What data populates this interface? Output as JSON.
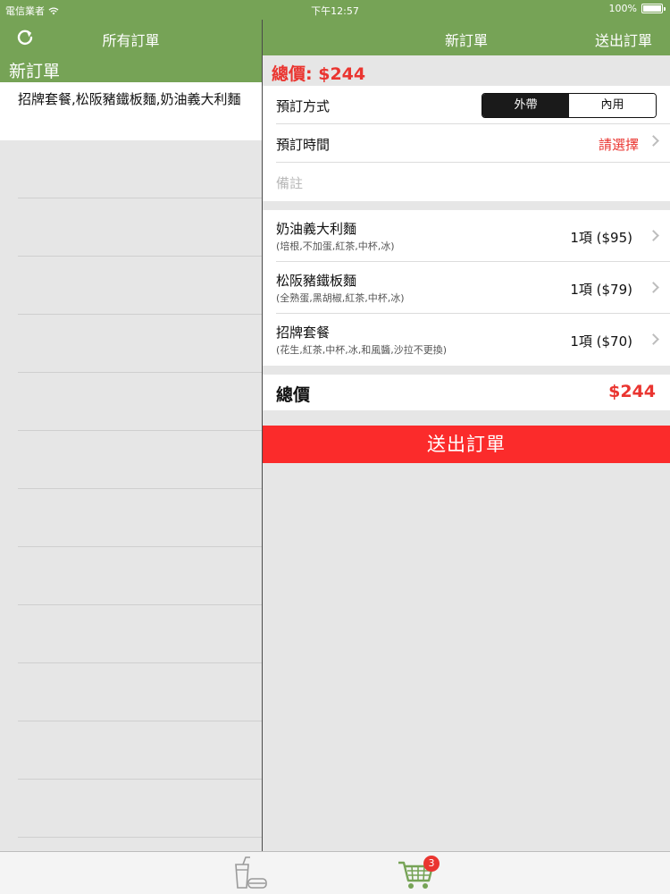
{
  "status": {
    "carrier": "電信業者",
    "time": "下午12:57",
    "battery": "100%"
  },
  "left_nav": {
    "title": "所有訂單"
  },
  "right_nav": {
    "title": "新訂單",
    "action": "送出訂單"
  },
  "orders": {
    "section_title": "新訂單",
    "items": [
      "招牌套餐,松阪豬鐵板麵,奶油義大利麵"
    ]
  },
  "summary": {
    "total_label": "總價:",
    "total_value": "$244"
  },
  "form": {
    "method_label": "預訂方式",
    "method_options": [
      "外帶",
      "內用"
    ],
    "method_selected": "外帶",
    "time_label": "預訂時間",
    "time_value": "請選擇",
    "note_placeholder": "備註"
  },
  "cart_items": [
    {
      "name": "奶油義大利麵",
      "options": "(培根,不加蛋,紅茶,中杯,冰)",
      "qty": "1項 ($95)"
    },
    {
      "name": "松阪豬鐵板麵",
      "options": "(全熟蛋,黑胡椒,紅茶,中杯,冰)",
      "qty": "1項 ($79)"
    },
    {
      "name": "招牌套餐",
      "options": "(花生,紅茶,中杯,冰,和風醬,沙拉不更換)",
      "qty": "1項 ($70)"
    }
  ],
  "total": {
    "label": "總價",
    "value": "$244"
  },
  "submit_label": "送出訂單",
  "tabbar": {
    "cart_badge": "3"
  },
  "colors": {
    "nav_green": "#76a356",
    "accent_red": "#ea3530",
    "submit_red": "#fb2b2b"
  }
}
